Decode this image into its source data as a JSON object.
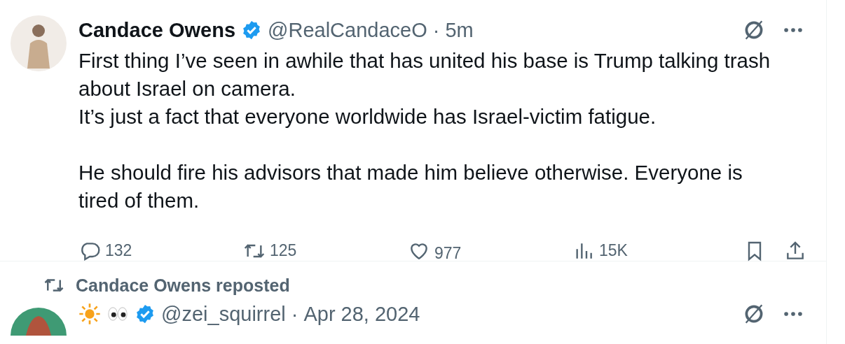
{
  "tweet": {
    "name": "Candace Owens",
    "verified": true,
    "handle": "@RealCandaceO",
    "separator": "·",
    "time": "5m",
    "text": "First thing I’ve seen in awhile that has united his base is Trump talking trash\nabout Israel on camera.\nIt’s just a fact that everyone worldwide has Israel-victim fatigue.\n\nHe should fire his advisors that made him believe otherwise. Everyone is\ntired of them.",
    "actions": [
      {
        "kind": "reply",
        "count": "132"
      },
      {
        "kind": "repost",
        "count": "125"
      },
      {
        "kind": "like",
        "count": "977"
      },
      {
        "kind": "views",
        "count": "15K"
      }
    ]
  },
  "repost_note": "Candace Owens reposted",
  "next_tweet": {
    "verified": true,
    "handle": "@zei_squirrel",
    "separator": "·",
    "time": "Apr 28, 2024"
  }
}
